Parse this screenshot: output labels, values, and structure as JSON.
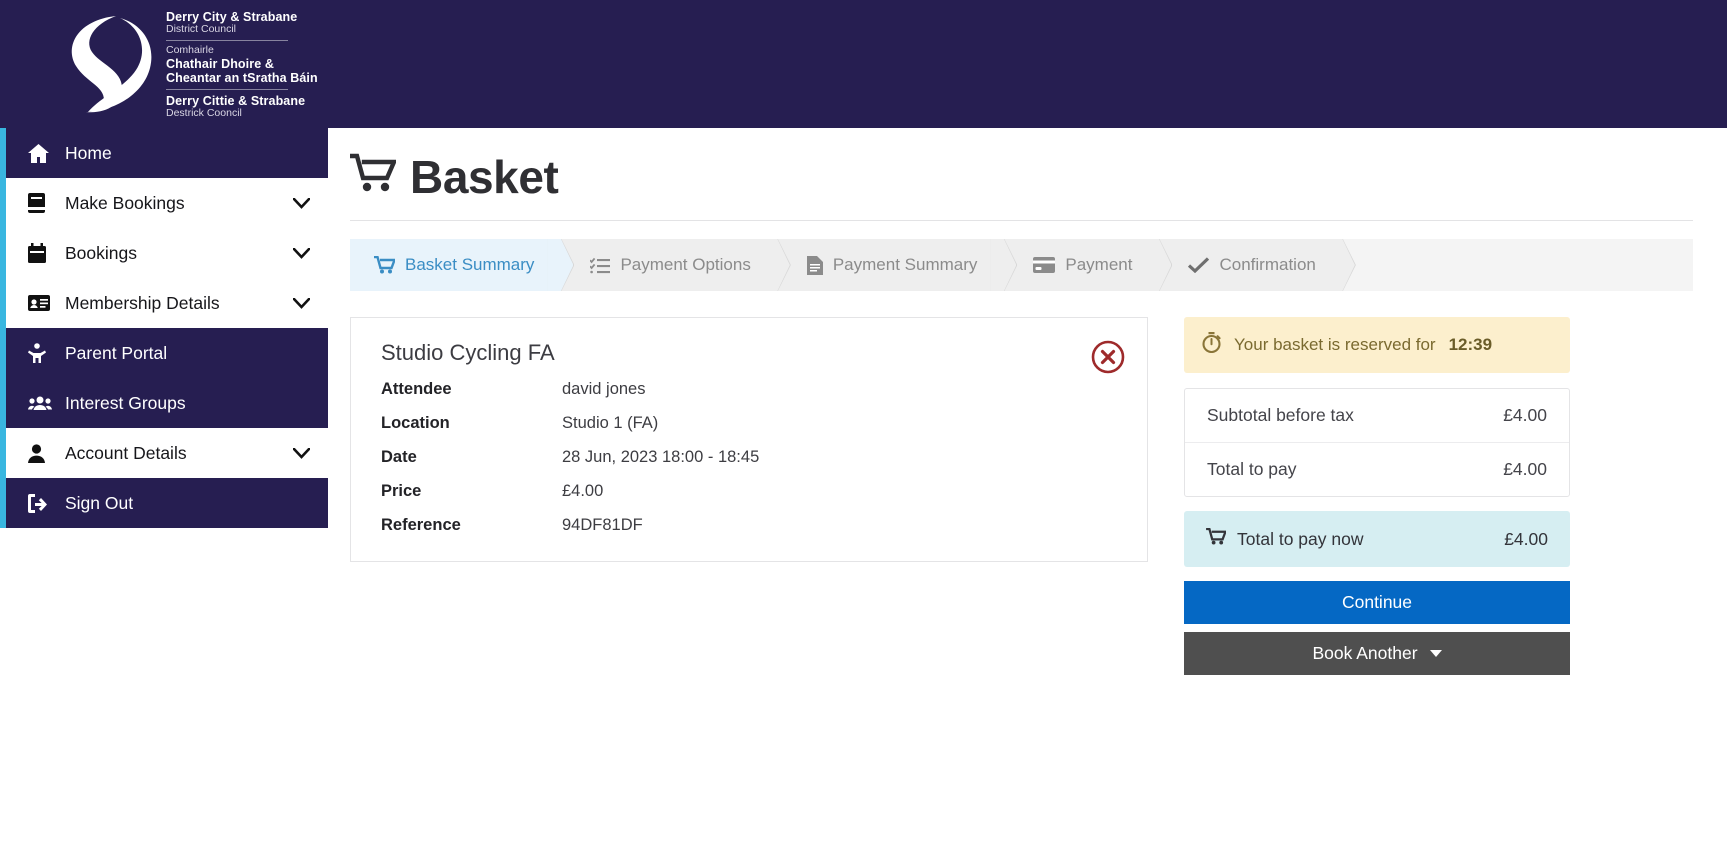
{
  "header": {
    "logo_lines": [
      {
        "text": "Derry City & Strabane",
        "style": "strong"
      },
      {
        "text": "District Council",
        "style": "light"
      },
      {
        "text": "Comhairle",
        "style": "light"
      },
      {
        "text": "Chathair Dhoire &",
        "style": "strong"
      },
      {
        "text": "Cheantar an tSratha Báin",
        "style": "strong"
      },
      {
        "text": "Derry Cittie & Strabane",
        "style": "strong"
      },
      {
        "text": "Destrick Cooncil",
        "style": "light"
      }
    ]
  },
  "sidebar": {
    "items": [
      {
        "label": "Home",
        "icon": "home-icon",
        "theme": "dark",
        "chevron": false
      },
      {
        "label": "Make Bookings",
        "icon": "book-icon",
        "theme": "light",
        "chevron": true
      },
      {
        "label": "Bookings",
        "icon": "calendar-icon",
        "theme": "light",
        "chevron": true
      },
      {
        "label": "Membership Details",
        "icon": "id-card-icon",
        "theme": "light",
        "chevron": true
      },
      {
        "label": "Parent Portal",
        "icon": "child-icon",
        "theme": "dark",
        "chevron": false
      },
      {
        "label": "Interest Groups",
        "icon": "users-icon",
        "theme": "dark",
        "chevron": false
      },
      {
        "label": "Account Details",
        "icon": "user-icon",
        "theme": "light",
        "chevron": true
      },
      {
        "label": "Sign Out",
        "icon": "sign-out-icon",
        "theme": "dark",
        "chevron": false
      }
    ]
  },
  "page": {
    "title": "Basket",
    "title_icon": "shopping-cart-icon"
  },
  "steps": [
    {
      "label": "Basket Summary",
      "icon": "cart-icon",
      "active": true
    },
    {
      "label": "Payment Options",
      "icon": "list-check-icon",
      "active": false
    },
    {
      "label": "Payment Summary",
      "icon": "document-icon",
      "active": false
    },
    {
      "label": "Payment",
      "icon": "credit-card-icon",
      "active": false
    },
    {
      "label": "Confirmation",
      "icon": "check-icon",
      "active": false
    }
  ],
  "basket_item": {
    "title": "Studio Cycling FA",
    "remove_icon": "remove-circle-icon",
    "details": [
      {
        "label": "Attendee",
        "value": "david jones"
      },
      {
        "label": "Location",
        "value": "Studio 1 (FA)"
      },
      {
        "label": "Date",
        "value": "28 Jun, 2023 18:00 - 18:45"
      },
      {
        "label": "Price",
        "value": "£4.00"
      },
      {
        "label": "Reference",
        "value": "94DF81DF"
      }
    ]
  },
  "summary": {
    "timer_icon": "stopwatch-icon",
    "timer_text": "Your basket is reserved for",
    "timer_value": "12:39",
    "totals": [
      {
        "label": "Subtotal before tax",
        "value": "£4.00"
      },
      {
        "label": "Total to pay",
        "value": "£4.00"
      }
    ],
    "total_now": {
      "icon": "cart-icon",
      "label": "Total to pay now",
      "value": "£4.00"
    },
    "continue_label": "Continue",
    "book_another_label": "Book Another"
  },
  "colors": {
    "brand_navy": "#261e51",
    "accent_cyan": "#39b6e0",
    "primary_blue": "#0568c4",
    "secondary_gray": "#4f4f4f",
    "timer_bg": "#fcefcd",
    "total_now_bg": "#d6eef2",
    "remove_red": "#9e2a2b",
    "active_step_bg": "#e8f3fb",
    "active_step_text": "#3a8dc4"
  }
}
